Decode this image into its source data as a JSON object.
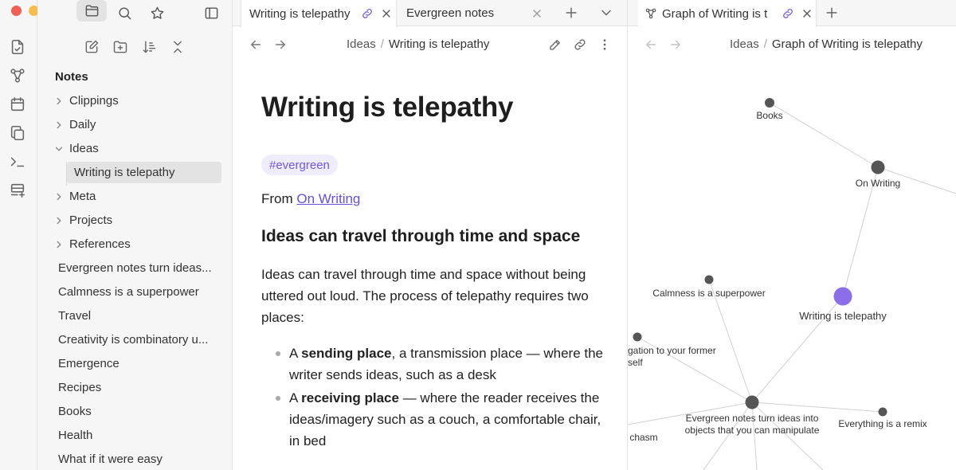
{
  "sidebar": {
    "vault_title": "Notes",
    "tree": [
      {
        "label": "Clippings",
        "type": "folder",
        "expanded": false
      },
      {
        "label": "Daily",
        "type": "folder",
        "expanded": false
      },
      {
        "label": "Ideas",
        "type": "folder",
        "expanded": true
      },
      {
        "label": "Writing is telepathy",
        "type": "file",
        "selected": true
      },
      {
        "label": "Meta",
        "type": "folder",
        "expanded": false
      },
      {
        "label": "Projects",
        "type": "folder",
        "expanded": false
      },
      {
        "label": "References",
        "type": "folder",
        "expanded": false
      },
      {
        "label": "Evergreen notes turn ideas...",
        "type": "file"
      },
      {
        "label": "Calmness is a superpower",
        "type": "file"
      },
      {
        "label": "Travel",
        "type": "file"
      },
      {
        "label": "Creativity is combinatory u...",
        "type": "file"
      },
      {
        "label": "Emergence",
        "type": "file"
      },
      {
        "label": "Recipes",
        "type": "file"
      },
      {
        "label": "Books",
        "type": "file"
      },
      {
        "label": "Health",
        "type": "file"
      },
      {
        "label": "What if it were easy",
        "type": "file"
      }
    ]
  },
  "editor": {
    "tabs": [
      {
        "title": "Writing is telepathy",
        "active": true
      },
      {
        "title": "Evergreen notes",
        "active": false
      }
    ],
    "breadcrumb": {
      "folder": "Ideas",
      "separator": "/",
      "current": "Writing is telepathy"
    },
    "note": {
      "title": "Writing is telepathy",
      "tag": "#evergreen",
      "from_prefix": "From ",
      "from_link": "On Writing",
      "heading": "Ideas can travel through time and space",
      "paragraph": "Ideas can travel through time and space without being uttered out loud. The process of telepathy requires two places:",
      "bullets": [
        {
          "prefix": "A ",
          "bold": "sending place",
          "rest": ", a transmission place — where the writer sends ideas, such as a desk"
        },
        {
          "prefix": "A ",
          "bold": "receiving place",
          "rest": " — where the reader receives the ideas/imagery such as a couch, a comfortable chair, in bed"
        }
      ]
    }
  },
  "graph": {
    "tab_title": "Graph of Writing is t",
    "breadcrumb": {
      "folder": "Ideas",
      "separator": "/",
      "current": "Graph of Writing is telepathy"
    },
    "nodes": [
      {
        "label": "Books"
      },
      {
        "label": "On Writing"
      },
      {
        "label": "Calmness is a superpower"
      },
      {
        "label": "Writing is telepathy",
        "current": true
      },
      {
        "label_line1": "gation to your former",
        "label_line2": "self"
      },
      {
        "label_line1": "Evergreen notes turn ideas into",
        "label_line2": "objects that you can manipulate"
      },
      {
        "label": "Everything is a remix"
      },
      {
        "label": "chasm"
      }
    ]
  },
  "colors": {
    "accent": "#7458d8",
    "link": "#6a4fd6",
    "current_node": "#8b6ee8",
    "node": "#555555",
    "edge": "#d0d0d0",
    "traffic_red": "#ee5f56",
    "traffic_yellow": "#f5bd4f",
    "traffic_green": "#61c454"
  }
}
